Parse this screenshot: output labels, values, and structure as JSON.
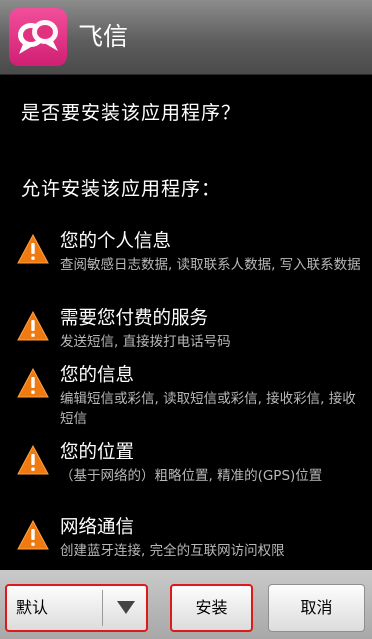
{
  "title_bar": {
    "app_name": "飞信",
    "icon": "fetion-app-icon"
  },
  "prompt": {
    "question": "是否要安装该应用程序？",
    "allow_heading": "允许安装该应用程序："
  },
  "permissions": [
    {
      "icon": "warning-icon",
      "title": "您的个人信息",
      "description": "查阅敏感日志数据, 读取联系人数据, 写入联系数据"
    },
    {
      "icon": "warning-icon",
      "title": "需要您付费的服务",
      "description": "发送短信, 直接拨打电话号码"
    },
    {
      "icon": "warning-icon",
      "title": "您的信息",
      "description": "编辑短信或彩信, 读取短信或彩信, 接收彩信, 接收短信"
    },
    {
      "icon": "warning-icon",
      "title": "您的位置",
      "description": "（基于网络的）粗略位置, 精准的(GPS)位置"
    },
    {
      "icon": "warning-icon",
      "title": "网络通信",
      "description": "创建蓝牙连接, 完全的互联网访问权限"
    }
  ],
  "buttons": {
    "default_label": "默认",
    "install_label": "安装",
    "cancel_label": "取消"
  },
  "colors": {
    "warning": "#f07a12",
    "highlight": "#e01818",
    "app_icon": "#e2327f"
  }
}
